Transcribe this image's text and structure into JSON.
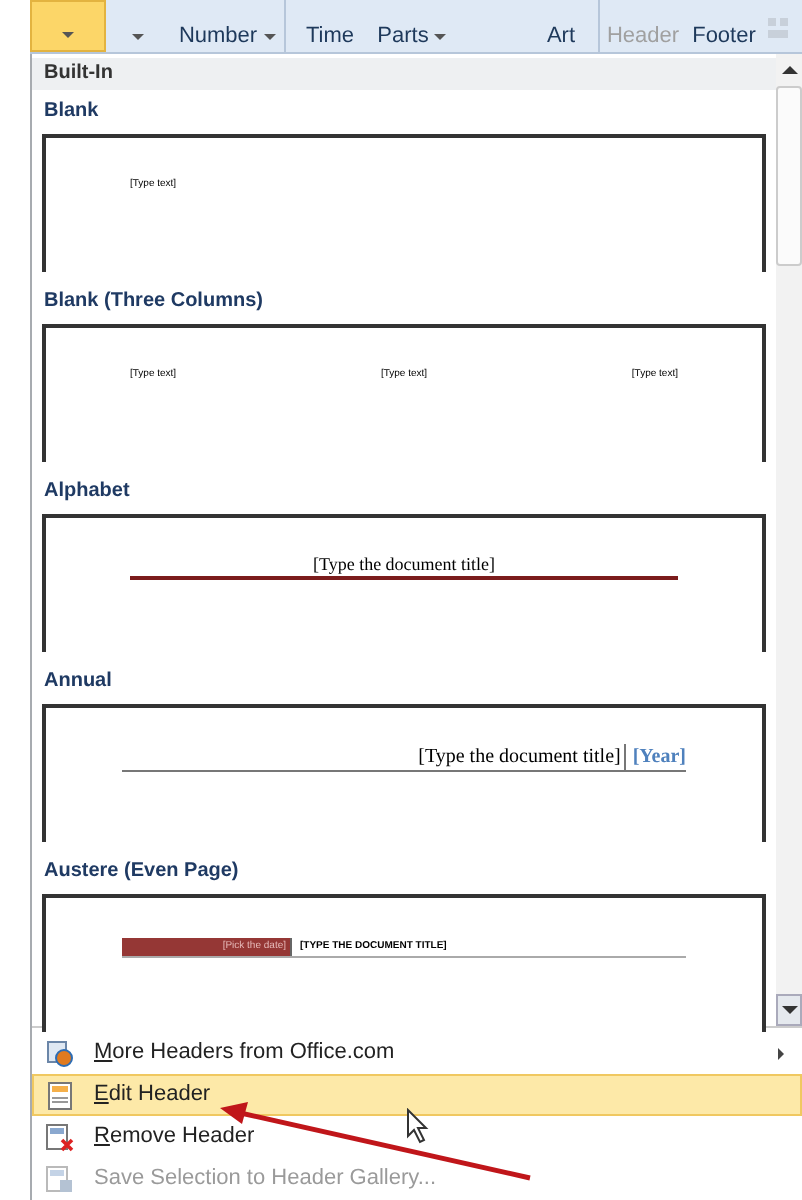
{
  "ribbon": {
    "buttons": [
      {
        "caret": true,
        "selected": true,
        "disabled": false
      },
      {
        "caret": true,
        "selected": false,
        "disabled": false
      },
      {
        "label": "Number",
        "caret": true,
        "selected": false,
        "disabled": false
      },
      {
        "label": "Time",
        "caret": false,
        "selected": false,
        "disabled": false
      },
      {
        "label": "Parts",
        "caret": true,
        "selected": false,
        "disabled": false
      },
      {
        "label": "Art",
        "caret": false,
        "selected": false,
        "disabled": false
      },
      {
        "label": "Header",
        "caret": false,
        "selected": false,
        "disabled": true
      },
      {
        "label": "Footer",
        "caret": false,
        "selected": false,
        "disabled": false
      }
    ]
  },
  "gallery": {
    "heading": "Built-In",
    "items": [
      {
        "kind": "blank",
        "title": "Blank",
        "texts": [
          "[Type text]"
        ]
      },
      {
        "kind": "three-columns",
        "title": "Blank (Three Columns)",
        "texts": [
          "[Type text]",
          "[Type text]",
          "[Type text]"
        ]
      },
      {
        "kind": "alphabet",
        "title": "Alphabet",
        "texts": [
          "[Type the document title]"
        ]
      },
      {
        "kind": "annual",
        "title": "Annual",
        "texts": [
          "[Type the document title]",
          "[Year]"
        ]
      },
      {
        "kind": "austere",
        "title": "Austere (Even Page)",
        "texts": [
          "[Pick the date]",
          "[TYPE THE DOCUMENT TITLE]"
        ]
      }
    ]
  },
  "menu": [
    {
      "kind": "more",
      "hotkey": "M",
      "text": "ore Headers from Office.com",
      "submenu": true,
      "selected": false,
      "disabled": false
    },
    {
      "kind": "edit",
      "hotkey": "E",
      "text": "dit Header",
      "submenu": false,
      "selected": true,
      "disabled": false
    },
    {
      "kind": "remove",
      "hotkey": "R",
      "text": "emove Header",
      "submenu": false,
      "selected": false,
      "disabled": false
    },
    {
      "kind": "save",
      "text": "Save Selection to Header Gallery...",
      "submenu": false,
      "selected": false,
      "disabled": true
    }
  ]
}
